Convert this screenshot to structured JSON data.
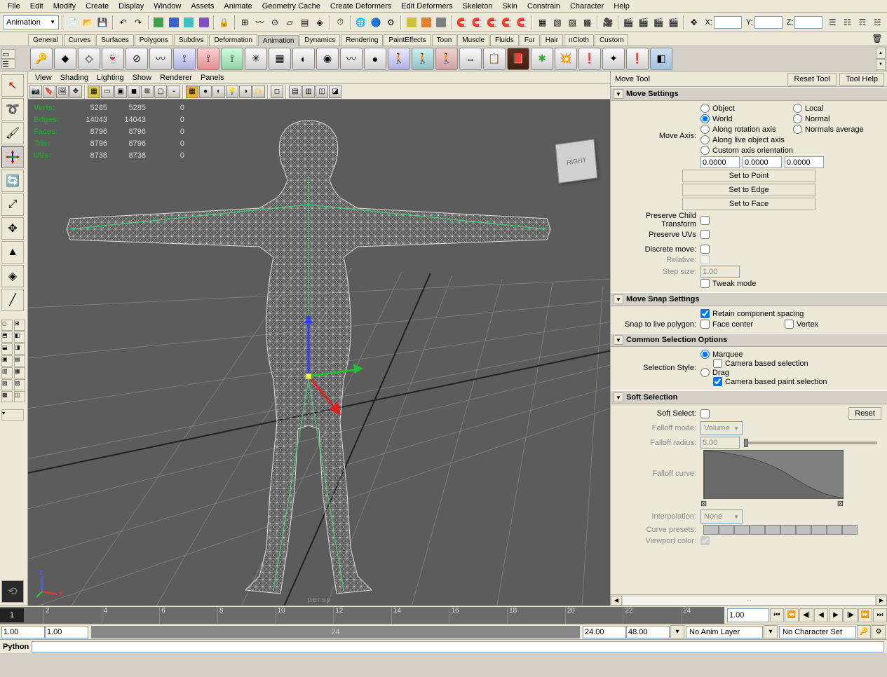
{
  "menubar": [
    "File",
    "Edit",
    "Modify",
    "Create",
    "Display",
    "Window",
    "Assets",
    "Animate",
    "Geometry Cache",
    "Create Deformers",
    "Edit Deformers",
    "Skeleton",
    "Skin",
    "Constrain",
    "Character",
    "Help"
  ],
  "mode_dropdown": "Animation",
  "coords": {
    "x_label": "X:",
    "y_label": "Y:",
    "z_label": "Z:",
    "x": "",
    "y": "",
    "z": ""
  },
  "shelf_tabs": [
    "General",
    "Curves",
    "Surfaces",
    "Polygons",
    "Subdivs",
    "Deformation",
    "Animation",
    "Dynamics",
    "Rendering",
    "PaintEffects",
    "Toon",
    "Muscle",
    "Fluids",
    "Fur",
    "Hair",
    "nCloth",
    "Custom"
  ],
  "shelf_active": "Animation",
  "panel_menu": [
    "View",
    "Shading",
    "Lighting",
    "Show",
    "Renderer",
    "Panels"
  ],
  "hud": {
    "verts": {
      "label": "Verts:",
      "a": "5285",
      "b": "5285",
      "c": "0"
    },
    "edges": {
      "label": "Edges:",
      "a": "14043",
      "b": "14043",
      "c": "0"
    },
    "faces": {
      "label": "Faces:",
      "a": "8796",
      "b": "8796",
      "c": "0"
    },
    "tris": {
      "label": "Tris:",
      "a": "8796",
      "b": "8796",
      "c": "0"
    },
    "uvs": {
      "label": "UVs:",
      "a": "8738",
      "b": "8738",
      "c": "0"
    }
  },
  "camera_label": "persp",
  "view_cube": "RIGHT",
  "tool": {
    "title": "Move Tool",
    "reset": "Reset Tool",
    "help": "Tool Help",
    "sections": {
      "move_settings": "Move Settings",
      "move_axis_label": "Move Axis:",
      "axis_opts": [
        "Object",
        "Local",
        "World",
        "Normal",
        "Along rotation axis",
        "Normals average",
        "Along live object axis",
        "Custom axis orientation"
      ],
      "axis_vals": [
        "0.0000",
        "0.0000",
        "0.0000"
      ],
      "set_point": "Set to Point",
      "set_edge": "Set to Edge",
      "set_face": "Set to Face",
      "preserve_child": "Preserve Child Transform",
      "preserve_uvs": "Preserve UVs",
      "discrete": "Discrete move:",
      "relative": "Relative:",
      "step": "Step size:",
      "step_val": "1.00",
      "tweak": "Tweak mode",
      "snap_settings": "Move Snap Settings",
      "retain": "Retain component spacing",
      "snap_label": "Snap to live polygon:",
      "face_center": "Face center",
      "vertex": "Vertex",
      "common_sel": "Common Selection Options",
      "sel_style": "Selection Style:",
      "marquee": "Marquee",
      "cam_sel": "Camera based selection",
      "drag": "Drag",
      "cam_paint": "Camera based paint selection",
      "soft_sel": "Soft Selection",
      "soft_label": "Soft Select:",
      "reset_btn": "Reset",
      "falloff_mode": "Falloff mode:",
      "falloff_mode_val": "Volume",
      "falloff_radius": "Falloff radius:",
      "falloff_radius_val": "5.00",
      "falloff_curve": "Falloff curve:",
      "interpolation": "Interpolation:",
      "interpolation_val": "None",
      "curve_presets": "Curve presets:",
      "viewport_color": "Viewport color:"
    }
  },
  "timeline": {
    "ticks": [
      2,
      4,
      6,
      8,
      10,
      12,
      14,
      16,
      18,
      20,
      22,
      24
    ],
    "current": "1",
    "frame_field": "1.00",
    "range_start": "1.00",
    "range_inner_start": "1.00",
    "range_inner_end": "24.00",
    "range_end": "48.00",
    "range_label": "24",
    "anim_layer": "No Anim Layer",
    "char_set": "No Character Set"
  },
  "status": {
    "lang": "Python"
  }
}
